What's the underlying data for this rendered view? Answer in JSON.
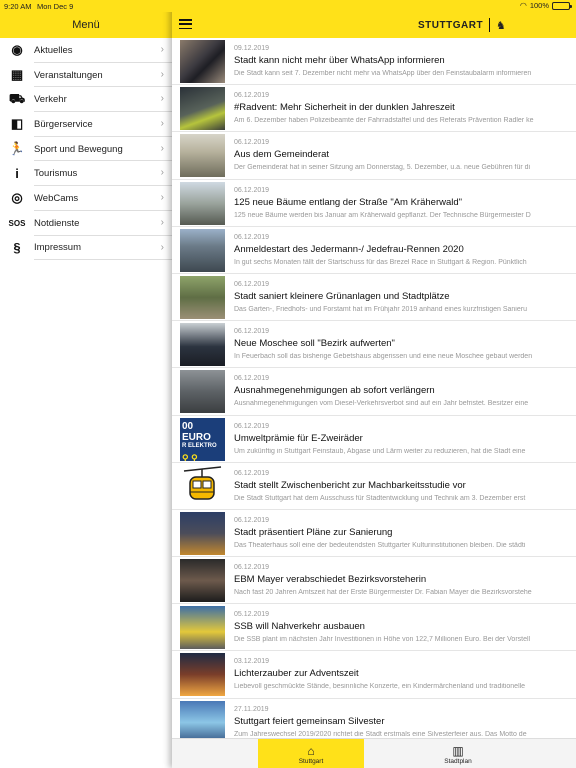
{
  "statusbar": {
    "time": "9:20 AM",
    "date": "Mon Dec 9",
    "battery": "100%"
  },
  "menu": {
    "title": "Menü",
    "items": [
      {
        "label": "Aktuelles",
        "icon": "rss-icon"
      },
      {
        "label": "Veranstaltungen",
        "icon": "calendar-icon"
      },
      {
        "label": "Verkehr",
        "icon": "traffic-icon"
      },
      {
        "label": "Bürgerservice",
        "icon": "citizen-service-icon"
      },
      {
        "label": "Sport und Bewegung",
        "icon": "running-icon"
      },
      {
        "label": "Tourismus",
        "icon": "info-icon"
      },
      {
        "label": "WebCams",
        "icon": "webcam-icon"
      },
      {
        "label": "Notdienste",
        "icon": "sos-icon"
      },
      {
        "label": "Impressum",
        "icon": "paragraph-icon"
      }
    ],
    "icon_glyphs": [
      "◉",
      "▦",
      "⛟",
      "◧",
      "🏃",
      "i",
      "◎",
      "SOS",
      "§"
    ]
  },
  "header": {
    "logo_text": "STUTTGART",
    "logo_icon": "horse-icon"
  },
  "news": [
    {
      "date": "09.12.2019",
      "title": "Stadt kann nicht mehr über WhatsApp informieren",
      "desc": "Die Stadt kann seit 7. Dezember nicht mehr via WhatsApp über den Feinstaubalarm informieren",
      "thumb": "phone-photo"
    },
    {
      "date": "06.12.2019",
      "title": "#Radvent: Mehr Sicherheit in der dunklen Jahreszeit",
      "desc": "Am 6. Dezember haben Polizeibeamte der Fahrradstaffel und des Referats Prävention Radler ke",
      "thumb": "cyclists-photo"
    },
    {
      "date": "06.12.2019",
      "title": "Aus dem Gemeinderat",
      "desc": "Der Gemeinderat hat in seiner Sitzung am Donnerstag, 5. Dezember, u.a. neue Gebühren für di",
      "thumb": "council-photo"
    },
    {
      "date": "06.12.2019",
      "title": "125 neue Bäume entlang der Straße \"Am Kräherwald\"",
      "desc": "125 neue Bäume werden bis Januar am Kräherwald gepflanzt. Der Technische Bürgermeister D",
      "thumb": "street-photo"
    },
    {
      "date": "06.12.2019",
      "title": "Anmeldestart des Jedermann-/ Jedefrau-Rennen 2020",
      "desc": "In gut sechs Monaten fällt der Startschuss für das Brezel Race in Stuttgart & Region. Pünktlich",
      "thumb": "race-photo"
    },
    {
      "date": "06.12.2019",
      "title": "Stadt saniert kleinere Grünanlagen und Stadtplätze",
      "desc": "Das Garten-, Friedhofs- und Forstamt hat im Frühjahr 2019 anhand eines kurzfristigen Sanieru",
      "thumb": "park-photo"
    },
    {
      "date": "06.12.2019",
      "title": "Neue Moschee soll \"Bezirk aufwerten\"",
      "desc": "In Feuerbach soll das bisherige Gebetshaus abgerissen und eine neue Moschee gebaut werden",
      "thumb": "group-photo"
    },
    {
      "date": "06.12.2019",
      "title": "Ausnahmegenehmigungen ab sofort verlängern",
      "desc": "Ausnahmegenehmigungen vom Diesel-Verkehrsverbot sind auf ein Jahr befristet. Besitzer eine",
      "thumb": "cars-photo"
    },
    {
      "date": "06.12.2019",
      "title": "Umweltprämie für E-Zweiräder",
      "desc": "Um zukünftig in Stuttgart Feinstaub, Abgase und Lärm weiter zu reduzieren, hat die Stadt eine",
      "thumb": "euro-banner",
      "thumb_text": [
        "00 EURO",
        "R ELEKTRO"
      ]
    },
    {
      "date": "06.12.2019",
      "title": "Stadt stellt Zwischenbericht zur Machbarkeitsstudie vor",
      "desc": "Die Stadt Stuttgart hat dem Ausschuss für Stadtentwicklung und Technik am 3. Dezember erst",
      "thumb": "cable-car-icon"
    },
    {
      "date": "06.12.2019",
      "title": "Stadt präsentiert Pläne zur Sanierung",
      "desc": "Das Theaterhaus soll eine der bedeutendsten Stuttgarter Kulturinstitutionen bleiben. Die städti",
      "thumb": "theater-photo"
    },
    {
      "date": "06.12.2019",
      "title": "EBM Mayer verabschiedet Bezirksvorsteherin",
      "desc": "Nach fast 20 Jahren Amtszeit hat der Erste Bürgermeister Dr. Fabian Mayer die Bezirksvorstehe",
      "thumb": "couple-photo"
    },
    {
      "date": "05.12.2019",
      "title": "SSB will Nahverkehr ausbauen",
      "desc": "Die SSB plant im nächsten Jahr Investitionen in Höhe von 122,7 Millionen Euro. Bei der Vorstell",
      "thumb": "tram-photo"
    },
    {
      "date": "03.12.2019",
      "title": "Lichterzauber zur Adventszeit",
      "desc": "Liebevoll geschmückte Stände, besinnliche Konzerte, ein Kindermärchenland und traditionelle",
      "thumb": "market-photo"
    },
    {
      "date": "27.11.2019",
      "title": "Stuttgart feiert gemeinsam Silvester",
      "desc": "Zum Jahreswechsel 2019/2020 richtet die Stadt erstmals eine Silvesterfeier aus. Das Motto de",
      "thumb": "silvester-photo"
    }
  ],
  "tabs": [
    {
      "label": "Stuttgart",
      "icon": "home-icon",
      "glyph": "⌂"
    },
    {
      "label": "Stadtplan",
      "icon": "map-icon",
      "glyph": "▥"
    }
  ],
  "colors": {
    "accent": "#ffe119"
  }
}
